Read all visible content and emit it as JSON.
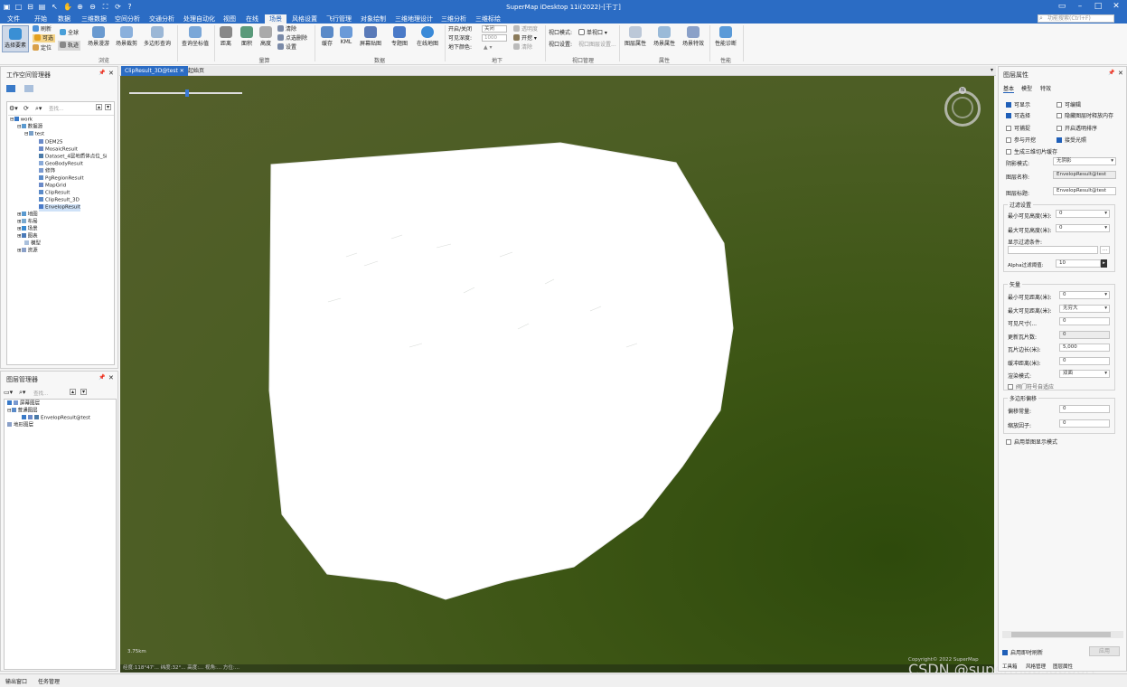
{
  "window": {
    "title": "SuperMap iDesktop 11i(2022)-[干丁]"
  },
  "menu_tabs": [
    "文件",
    "开始",
    "数据",
    "三维数据",
    "空间分析",
    "交通分析",
    "处理自动化",
    "视图",
    "在线",
    "场景",
    "风格设置",
    "飞行管理",
    "对象绘制",
    "三维地理设计",
    "三维分析",
    "三维标绘"
  ],
  "active_tab_index": 9,
  "search": {
    "placeholder": "功能搜索(Ctrl+F)"
  },
  "ribbon": {
    "browse": {
      "btn_select": "选择要素",
      "btn_refresh": "刷新",
      "btn_fullview": "全球",
      "btn_viewable": "可选",
      "btn_locate": "定位",
      "btn_track": "轨迹",
      "btn_roam": "场景漫游",
      "btn_clip": "场景裁剪",
      "btn_polygon_query": "多边形查询",
      "label": "浏览"
    },
    "query": {
      "btn_coord": "查询坐标值"
    },
    "measure": {
      "btn_distance": "距离",
      "btn_area": "面积",
      "btn_height": "高度",
      "btn_clear": "清除",
      "btn_clear_point": "点选删除",
      "btn_settings": "设置",
      "label": "量算"
    },
    "data": {
      "btn_cache": "缓存",
      "btn_kml": "KML",
      "btn_screen": "屏幕贴图",
      "btn_theme": "专题图",
      "btn_online": "在线地图",
      "label": "数据"
    },
    "underground": {
      "lbl_toggle": "开启/关闭",
      "val_toggle": "关闭",
      "lbl_depth": "可见深度:",
      "val_depth": "1000",
      "lbl_color": "地下颜色:",
      "btn_transparency": "透明度",
      "btn_excavate": "开挖",
      "btn_clear": "清除",
      "label": "地下"
    },
    "viewport": {
      "lbl_mode": "视口模式:",
      "val_mode": "单视口",
      "lbl_settings": "视口设置:",
      "val_settings": "视口图层设置...",
      "label": "视口管理"
    },
    "props": {
      "btn_layer": "图层属性",
      "btn_scene": "场景属性",
      "btn_effects": "场景特效",
      "label": "属性"
    },
    "perf": {
      "btn_diag": "性能诊断",
      "label": "性能"
    }
  },
  "workspace": {
    "title": "工作空间管理器",
    "search_placeholder": "查找...",
    "items": [
      "work",
      "数据源",
      "test",
      "DEM25",
      "MosaicResult",
      "Dataset_4层地质体点位_Si",
      "GeoBodyResult",
      "修饰",
      "PgRegionResult",
      "MapGrid",
      "ClipResult",
      "ClipResult_3D",
      "EnvelopResult",
      "地图",
      "布局",
      "场景",
      "图表",
      "模型",
      "资源"
    ]
  },
  "layers": {
    "title": "图层管理器",
    "search_placeholder": "查找...",
    "items": [
      "屏幕图层",
      "普通图层",
      "EnvelopResult@test",
      "地形图层"
    ]
  },
  "doc_tabs": {
    "active": "ClipResult_3D@test",
    "start": "起始页"
  },
  "map": {
    "compass": "N",
    "watermark": "CSDN @supermapsupport",
    "copyright": "Copyright© 2022 SuperMap",
    "scale": "3.75km",
    "status": "经度:118°47'...  纬度:32°... 高度:...  视角:...  方位:..."
  },
  "properties": {
    "title": "图层属性",
    "tabs": [
      "基本",
      "模型",
      "特效"
    ],
    "checks": [
      {
        "label": "可显示",
        "on": true
      },
      {
        "label": "可编辑",
        "on": false
      },
      {
        "label": "可选择",
        "on": true
      },
      {
        "label": "隐藏图层时释放内存",
        "on": false
      },
      {
        "label": "可捕捉",
        "on": false
      },
      {
        "label": "开启透明排序",
        "on": false
      },
      {
        "label": "参与开挖",
        "on": false
      },
      {
        "label": "接受光照",
        "on": true
      },
      {
        "label": "生成三维切片缓存",
        "on": false
      }
    ],
    "shadow_label": "阴影模式:",
    "shadow_value": "无阴影",
    "name_label": "图层名称:",
    "name_value": "EnvelopResult@test",
    "caption_label": "图层标题:",
    "caption_value": "EnvelopResult@test",
    "filter": {
      "title": "过滤设置",
      "min_label": "最小可见高度(米):",
      "min_value": "0",
      "max_label": "最大可见高度(米):",
      "max_value": "0",
      "cond_label": "显示过滤条件:",
      "cond_value": "",
      "alpha_label": "Alpha过滤阈值:",
      "alpha_value": "10"
    },
    "vector": {
      "title": "矢量",
      "min_label": "最小可见距离(米):",
      "min_value": "0",
      "max_label": "最大可见距离(米):",
      "max_value": "无穷大",
      "size_label": "可见尺寸(...",
      "size_value": "0",
      "tiles_label": "更新瓦片数:",
      "tiles_value": "0",
      "edge_label": "瓦片边长(米):",
      "edge_value": "5,000",
      "buffer_label": "缓冲距离(米):",
      "buffer_value": "0",
      "render_label": "渲染模式:",
      "render_value": "双面",
      "adapt_label": "阀门符号自适应"
    },
    "offset": {
      "title": "多边形偏移",
      "const_label": "偏移常量:",
      "const_value": "0",
      "factor_label": "缩放因子:",
      "factor_value": "0"
    },
    "single_mode": "启用单图显示模式",
    "realtime": "启用即时刷新",
    "apply": "应用",
    "bottom_tabs": [
      "工具箱",
      "风格管理",
      "图层属性"
    ]
  },
  "statusbar": {
    "output": "输出窗口",
    "tasks": "任务管理"
  }
}
